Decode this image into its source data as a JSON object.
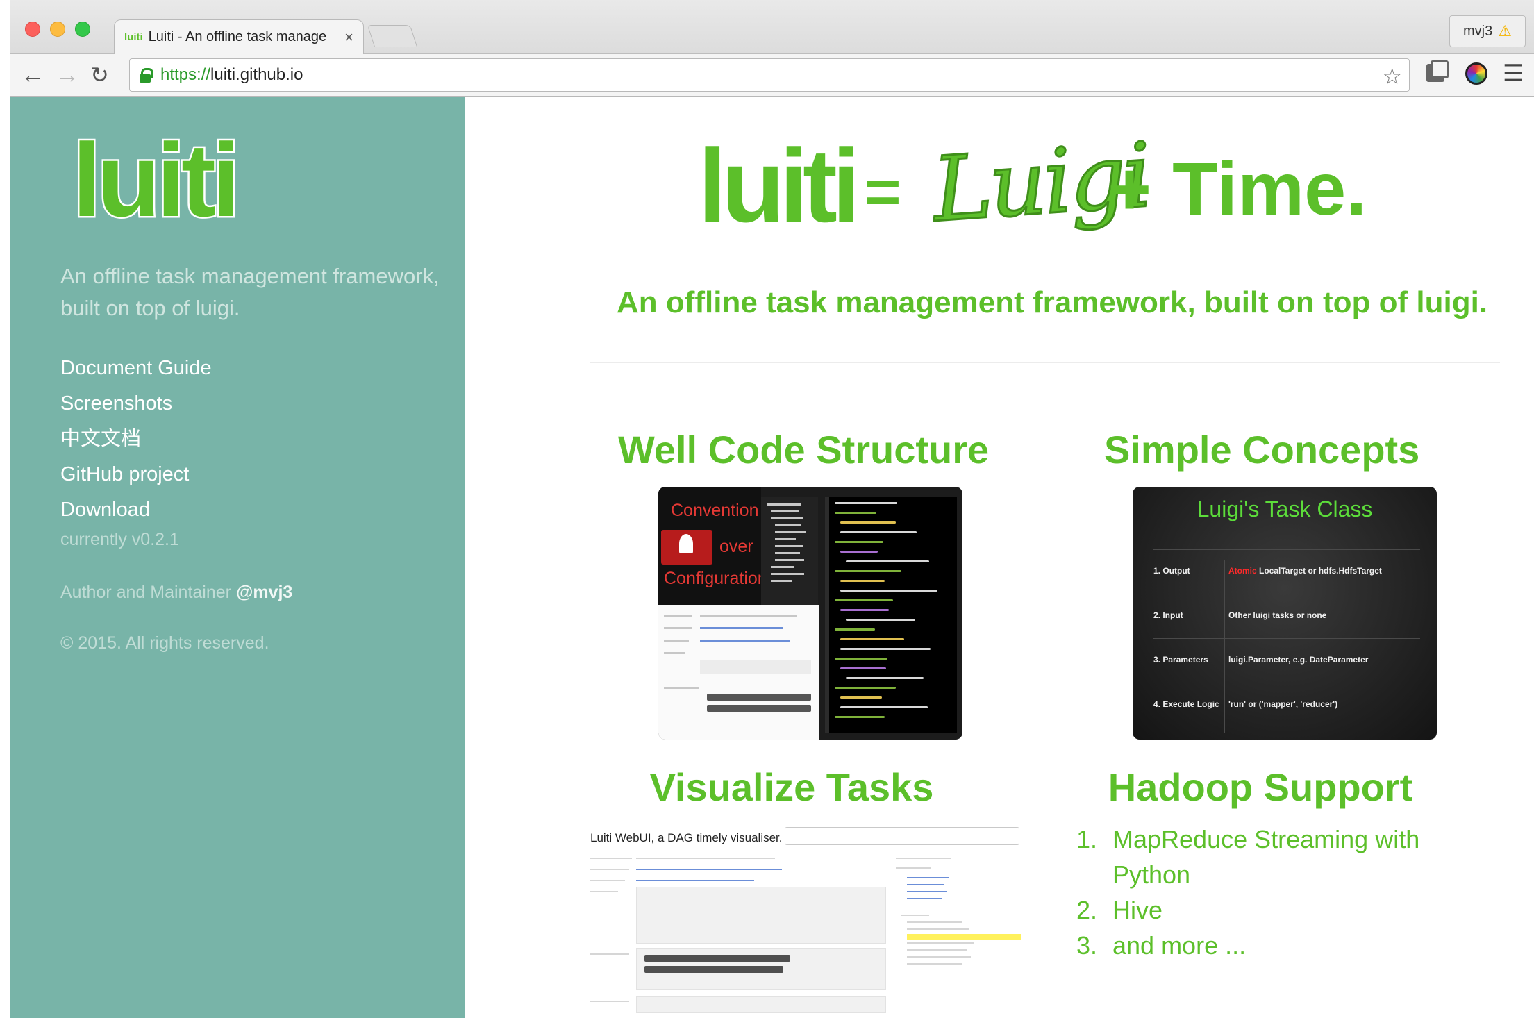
{
  "browser": {
    "tab_title": "Luiti - An offline task manage",
    "tab_favicon_text": "luiti",
    "tab_close": "×",
    "profile_name": "mvj3",
    "url_scheme": "https://",
    "url_host": "luiti.github.io",
    "icons": {
      "back": "←",
      "forward": "→",
      "reload": "↻",
      "star": "☆",
      "menu": "☰",
      "warning": "⚠"
    }
  },
  "sidebar": {
    "logo_text": "luiti",
    "tagline": "An offline task management framework, built on top of luigi.",
    "nav": [
      {
        "label": "Document Guide"
      },
      {
        "label": "Screenshots"
      },
      {
        "label": "中文文档"
      },
      {
        "label": "GitHub project"
      },
      {
        "label": "Download"
      }
    ],
    "version": "currently v0.2.1",
    "author_prefix": "Author and Maintainer ",
    "author_handle": "@mvj3",
    "copyright": "© 2015. All rights reserved."
  },
  "main": {
    "hero": {
      "luiti": "luiti",
      "equals": "=",
      "luigi": "Luigi",
      "plus_time": "+ Time."
    },
    "tagline": "An offline task management framework, built on top of luigi.",
    "features": {
      "code_title": "Well Code Structure",
      "concepts_title": "Simple Concepts",
      "visualize_title": "Visualize Tasks",
      "hadoop_title": "Hadoop Support"
    },
    "code_shot": {
      "line1": "Convention",
      "line2": "over",
      "line3": "Configuration"
    },
    "task_class": {
      "heading": "Luigi's Task Class",
      "rows": [
        {
          "label": "1. Output",
          "atomic": "Atomic",
          "value": " LocalTarget or hdfs.HdfsTarget"
        },
        {
          "label": "2. Input",
          "atomic": "",
          "value": "Other luigi tasks or none"
        },
        {
          "label": "3. Parameters",
          "atomic": "",
          "value": "luigi.Parameter, e.g. DateParameter"
        },
        {
          "label": "4. Execute Logic",
          "atomic": "",
          "value": "'run' or ('mapper', 'reducer')"
        }
      ]
    },
    "visualiser": {
      "title": "Luiti WebUI, a DAG timely visualiser."
    },
    "hadoop_list": [
      {
        "num": "1.",
        "text": "MapReduce Streaming with Python"
      },
      {
        "num": "2.",
        "text": "Hive"
      },
      {
        "num": "3.",
        "text": "and more ..."
      }
    ]
  },
  "colors": {
    "brand_green": "#5cbf2a",
    "sidebar_bg": "#78b4a8"
  }
}
